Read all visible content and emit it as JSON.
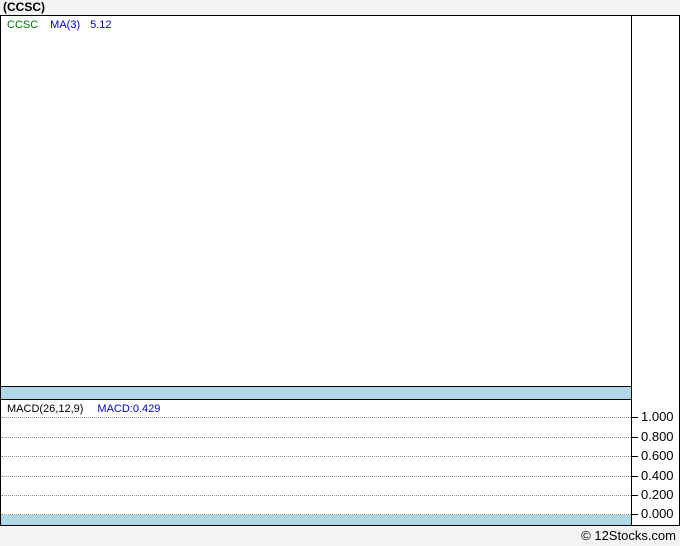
{
  "window": {
    "title": "(CCSC)"
  },
  "main_chart": {
    "legend": {
      "symbol": "CCSC",
      "ma_label": "MA(3)",
      "ma_value": "5.12"
    }
  },
  "macd": {
    "label": "MACD(26,12,9)",
    "value": "MACD:0.429",
    "ticks": [
      "1.000",
      "0.800",
      "0.600",
      "0.400",
      "0.200",
      "0.000"
    ]
  },
  "footer": {
    "credit": "© 12Stocks.com"
  },
  "colors": {
    "separator_band": "#aed8e6",
    "symbol_green": "#007700",
    "indicator_blue": "#0000cc",
    "gridline_gray": "#909090",
    "page_bg": "#f4f4f4",
    "frame_border": "#000000"
  },
  "chart_data": [
    {
      "type": "line",
      "title": "(CCSC) price panel",
      "series": [
        {
          "name": "CCSC",
          "values": []
        },
        {
          "name": "MA(3)",
          "values": []
        }
      ],
      "annotations": [
        "MA(3) latest value: 5.12"
      ],
      "grid": false,
      "note": "price panel is blank in the screenshot - no candles or line plotted"
    },
    {
      "type": "line",
      "title": "MACD(26,12,9)",
      "ylim": [
        0.0,
        1.0
      ],
      "yticks": [
        1.0,
        0.8,
        0.6,
        0.4,
        0.2,
        0.0
      ],
      "grid": true,
      "series": [
        {
          "name": "MACD",
          "values": []
        }
      ],
      "annotations": [
        "MACD latest value: 0.429"
      ],
      "note": "MACD panel shows only dotted horizontal gridlines - no curve plotted"
    }
  ]
}
